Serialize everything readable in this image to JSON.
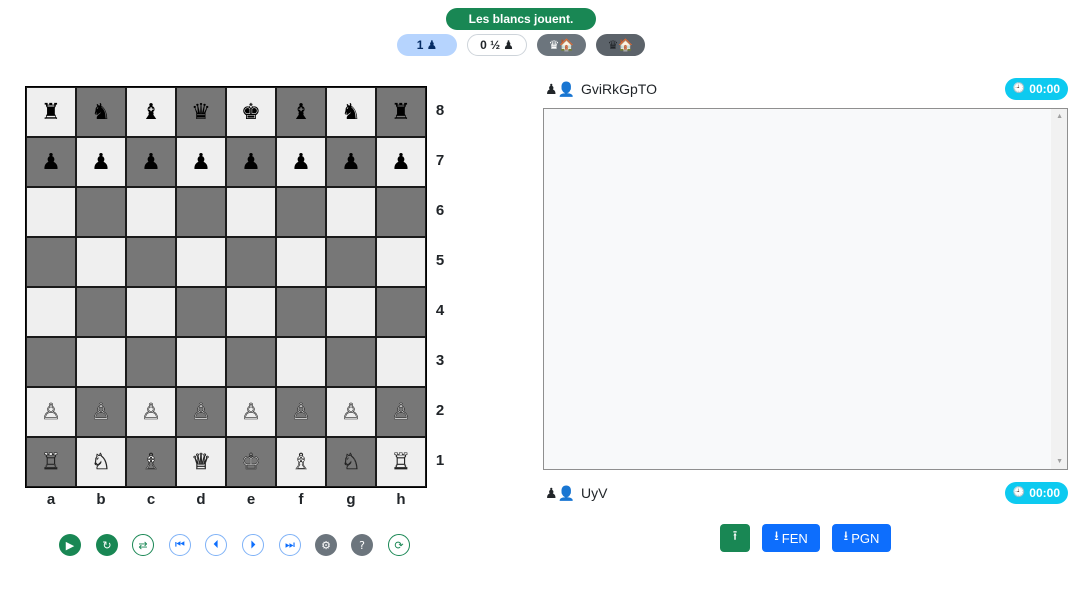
{
  "status": "Les blancs jouent.",
  "scores": {
    "score_value": "1",
    "draw_value": "0 ½",
    "pawn_glyph": "♟",
    "home_glyph_white": "♛🏠",
    "home_glyph_black": "♛🏠"
  },
  "board": {
    "ranks": [
      "8",
      "7",
      "6",
      "5",
      "4",
      "3",
      "2",
      "1"
    ],
    "files": [
      "a",
      "b",
      "c",
      "d",
      "e",
      "f",
      "g",
      "h"
    ],
    "rows": [
      [
        "♜",
        "♞",
        "♝",
        "♛",
        "♚",
        "♝",
        "♞",
        "♜"
      ],
      [
        "♟",
        "♟",
        "♟",
        "♟",
        "♟",
        "♟",
        "♟",
        "♟"
      ],
      [
        "",
        "",
        "",
        "",
        "",
        "",
        "",
        ""
      ],
      [
        "",
        "",
        "",
        "",
        "",
        "",
        "",
        ""
      ],
      [
        "",
        "",
        "",
        "",
        "",
        "",
        "",
        ""
      ],
      [
        "",
        "",
        "",
        "",
        "",
        "",
        "",
        ""
      ],
      [
        "♙",
        "♙",
        "♙",
        "♙",
        "♙",
        "♙",
        "♙",
        "♙"
      ],
      [
        "♖",
        "♘",
        "♗",
        "♕",
        "♔",
        "♗",
        "♘",
        "♖"
      ]
    ]
  },
  "controls": [
    {
      "name": "play-icon",
      "glyph": "▶"
    },
    {
      "name": "redo-icon",
      "glyph": "↻"
    },
    {
      "name": "flip-board-icon",
      "glyph": "⇄"
    },
    {
      "name": "first-move-icon",
      "glyph": "⏮"
    },
    {
      "name": "previous-move-icon",
      "glyph": "⏴"
    },
    {
      "name": "next-move-icon",
      "glyph": "⏵"
    },
    {
      "name": "last-move-icon",
      "glyph": "⏭"
    },
    {
      "name": "settings-icon",
      "glyph": "⚙"
    },
    {
      "name": "help-icon",
      "glyph": "?"
    },
    {
      "name": "refresh-icon",
      "glyph": "⟳"
    }
  ],
  "players": {
    "top": {
      "name": "GviRkGpTO",
      "timer": "00:00",
      "icons": "♟👤"
    },
    "bottom": {
      "name": "UyV",
      "timer": "00:00",
      "icons": "♟👤"
    }
  },
  "actions": {
    "upload_glyph": "⭱",
    "fen_label": "FEN",
    "pgn_label": "PGN",
    "download_glyph": "⭳"
  },
  "icons": {
    "clock": "🕘",
    "scroll_up": "▲",
    "scroll_down": "▼"
  }
}
